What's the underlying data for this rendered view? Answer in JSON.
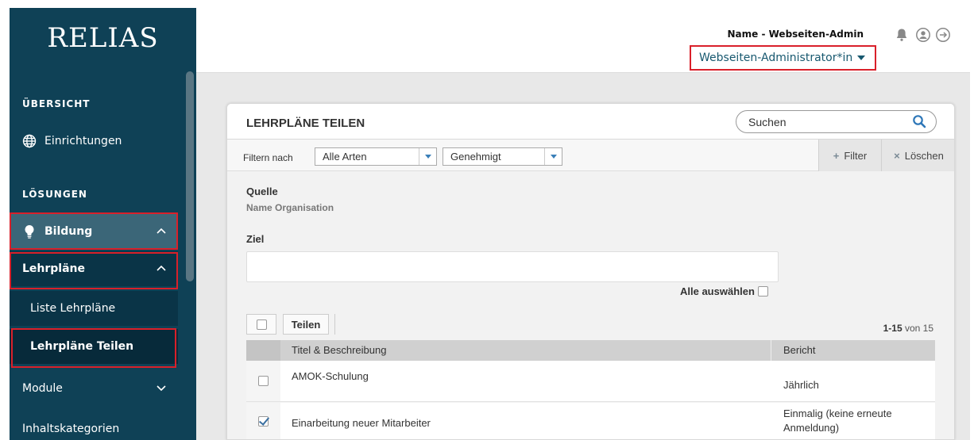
{
  "app": {
    "logo_text": "RELIAS"
  },
  "header": {
    "user_name": "Name - Webseiten-Admin",
    "role": "Webseiten-Administrator*in",
    "icons": [
      "bell-icon",
      "user-circle-icon",
      "logout-icon"
    ]
  },
  "sidebar": {
    "section_overview": "ÜBERSICHT",
    "item_facilities": "Einrichtungen",
    "section_solutions": "LÖSUNGEN",
    "item_education": "Bildung",
    "item_curricula": "Lehrpläne",
    "sub_list_curricula": "Liste Lehrpläne",
    "sub_share_curricula": "Lehrpläne Teilen",
    "item_modules": "Module",
    "item_content_categories": "Inhaltskategorien"
  },
  "panel": {
    "title": "LEHRPLÄNE TEILEN",
    "search_placeholder": "Suchen",
    "filter_label": "Filtern nach",
    "filter_type": "Alle Arten",
    "filter_status": "Genehmigt",
    "btn_filter": "Filter",
    "btn_clear": "Löschen",
    "source_label": "Quelle",
    "source_value": "Name Organisation",
    "target_label": "Ziel",
    "select_all": "Alle auswählen",
    "share_button": "Teilen",
    "pager_range": "1-15",
    "pager_of": " von 15"
  },
  "table": {
    "col_title": "Titel & Beschreibung",
    "col_report": "Bericht",
    "rows": [
      {
        "title": "AMOK-Schulung",
        "report": "Jährlich",
        "checked": false
      },
      {
        "title": "Einarbeitung neuer Mitarbeiter",
        "report": "Einmalig (keine erneute Anmeldung)",
        "checked": true
      }
    ]
  },
  "colors": {
    "sidebar_bg": "#0f4156",
    "highlight": "#d9202a",
    "accent": "#3a7fb8"
  }
}
